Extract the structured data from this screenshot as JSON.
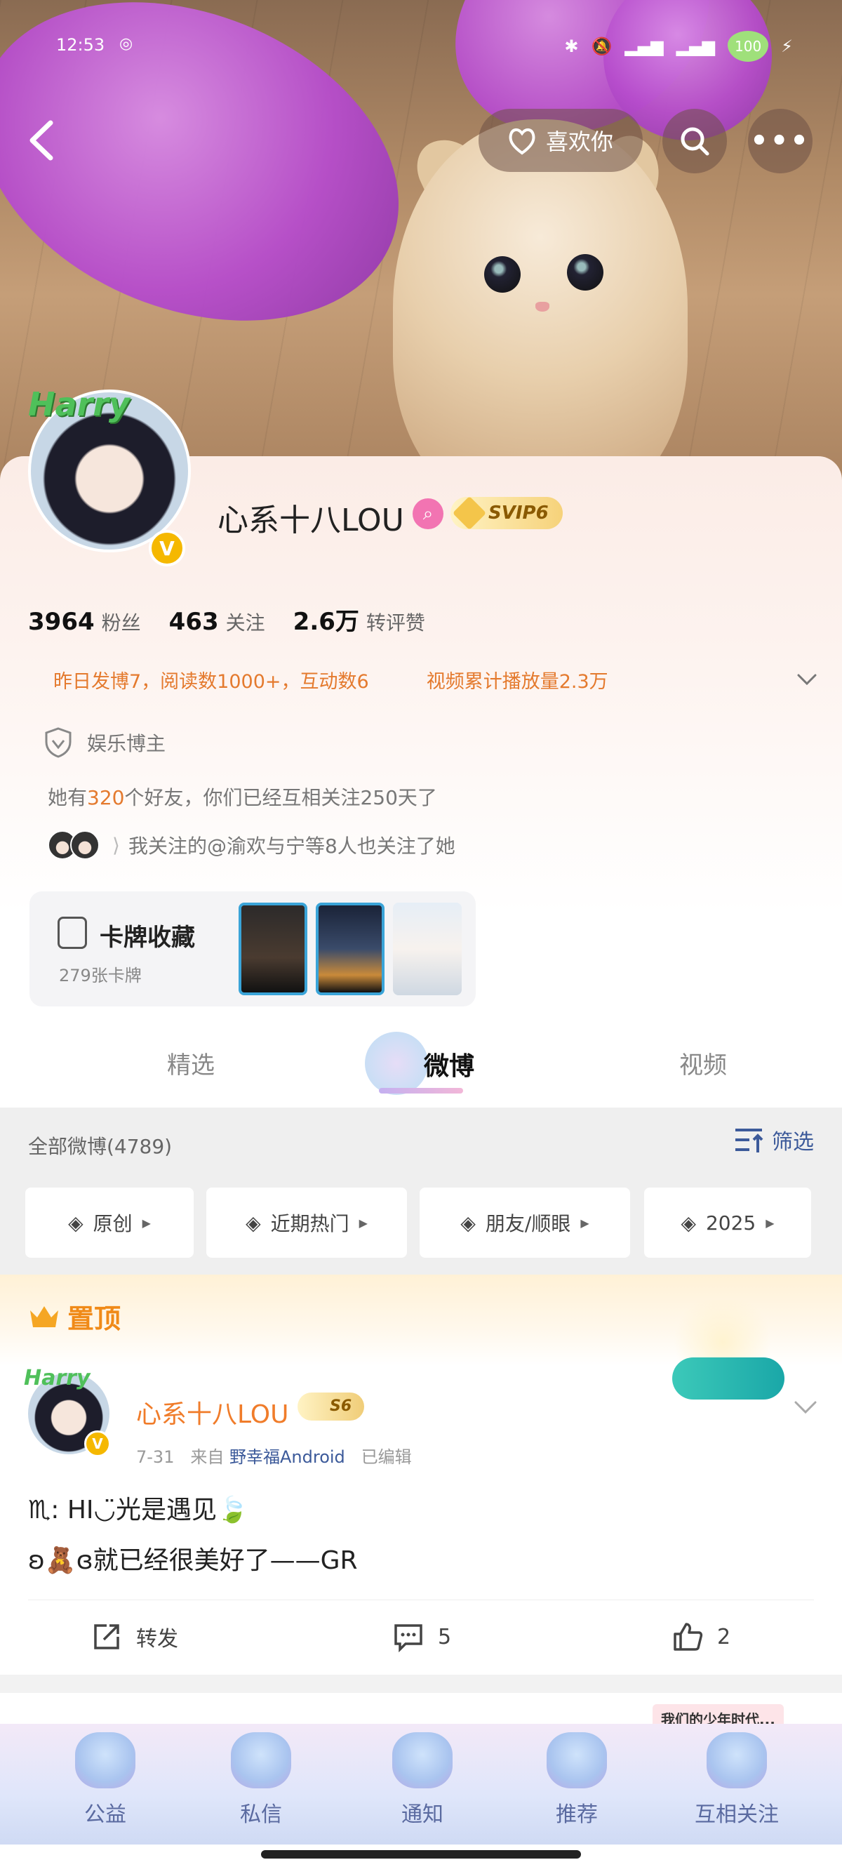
{
  "status_bar": {
    "time": "12:53",
    "battery": "100",
    "colors": {
      "battery_heart": "#9fe07b",
      "icons": "#4cbf4c"
    }
  },
  "header": {
    "like_label": "喜欢你",
    "icons": [
      "back-icon",
      "heart-hand-icon",
      "search-icon",
      "more-icon"
    ]
  },
  "profile": {
    "avatar_frame_text": "Harry",
    "name": "心系十八LOU",
    "vip_label": "SVIP6",
    "stats": [
      {
        "value": "3964",
        "label": "粉丝"
      },
      {
        "value": "463",
        "label": "关注"
      },
      {
        "value": "2.6万",
        "label": "转评赞"
      }
    ],
    "info": {
      "yesterday": "昨日发博7，阅读数1000+，互动数6",
      "video": "视频累计播放量2.3万"
    },
    "tag": "娱乐博主",
    "friends": {
      "prefix": "她有",
      "count": "320",
      "suffix": "个好友，你们已经互相关注250天了"
    },
    "mutual_follow": "我关注的@渝欢与宁等8人也关注了她",
    "cards": {
      "title": "卡牌收藏",
      "count": "279张卡牌"
    }
  },
  "tabs": [
    {
      "label": "精选"
    },
    {
      "label": "微博",
      "active": true
    },
    {
      "label": "视频"
    }
  ],
  "filter": {
    "all_label": "全部微博(4789)",
    "filter_label": "筛选",
    "chips": [
      "原创",
      "近期热门",
      "朋友/顺眼",
      "2025"
    ]
  },
  "pinned_post": {
    "pin_label": "置顶",
    "author": "心系十八LOU",
    "rank": "S6",
    "date": "7-31",
    "source_prefix": "来自",
    "source": "野幸福Android",
    "edited": "已编辑",
    "text": "♏︎: HI◡̈光是遇见🍃\nʚ🧸ɞ就已经很美好了——GR",
    "actions": {
      "repost": "转发",
      "comments": "5",
      "likes": "2"
    }
  },
  "next_post": {
    "tag": "我们的少年时代..."
  },
  "bottom_nav": [
    {
      "label": "公益"
    },
    {
      "label": "私信"
    },
    {
      "label": "通知"
    },
    {
      "label": "推荐"
    },
    {
      "label": "互相关注"
    }
  ],
  "colors": {
    "accent_orange": "#e47a2e",
    "link_blue": "#3c5a9a",
    "vip_gold": "#f5b800"
  }
}
